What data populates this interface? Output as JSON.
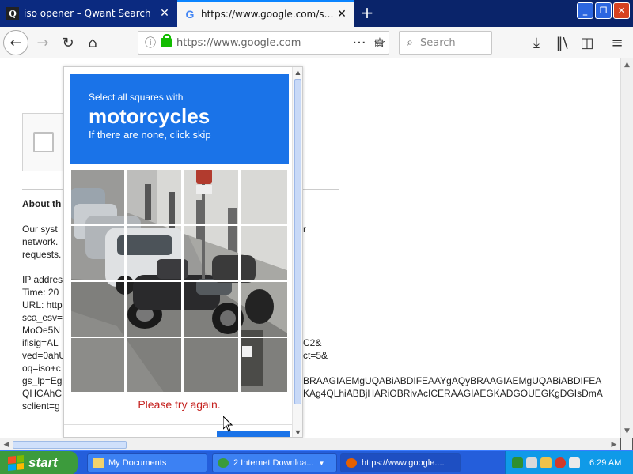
{
  "browser": {
    "tabs": [
      {
        "title": "iso opener – Qwant Search",
        "favicon": "Q",
        "active": false
      },
      {
        "title": "https://www.google.com/search?",
        "favicon": "G",
        "active": true
      }
    ],
    "new_tab_label": "+",
    "url": "https://www.google.com",
    "search_placeholder": "Search"
  },
  "page": {
    "about_heading": "About th",
    "para_lines": [
      "Our syst",
      "network.",
      "requests."
    ],
    "para_right": "r",
    "info_lines": [
      "IP addres",
      "Time: 20",
      "URL: http",
      "sca_esv=",
      "MoOe5N",
      "iflsig=AL",
      "ved=0ahU",
      "oq=iso+c",
      "gs_lp=Eg",
      "QHCAhC",
      "sclient=g"
    ],
    "info_right": [
      "C2&",
      "ct=5&",
      "BRAAGIAEMgUQABiABDIFEAAYgAQyBRAAGIAEMgUQABiABDIFEA",
      "KAg4QLhiABBjHARiOBRivAcICERAAGIAEGKADGOUEGKgDGIsDmA"
    ]
  },
  "captcha": {
    "instruction_line1": "Select all squares with",
    "target": "motorcycles",
    "instruction_line3": "If there are none, click skip",
    "error": "Please try again.",
    "grid_rows": 4,
    "grid_cols": 4,
    "header_color": "#1a73e8"
  },
  "taskbar": {
    "start_label": "start",
    "tasks": [
      {
        "label": "My Documents",
        "icon": "folder-icon"
      },
      {
        "label": "2 Internet Downloa...",
        "icon": "ie-icon"
      },
      {
        "label": "https://www.google....",
        "icon": "firefox-icon"
      }
    ],
    "clock": "6:29 AM"
  }
}
